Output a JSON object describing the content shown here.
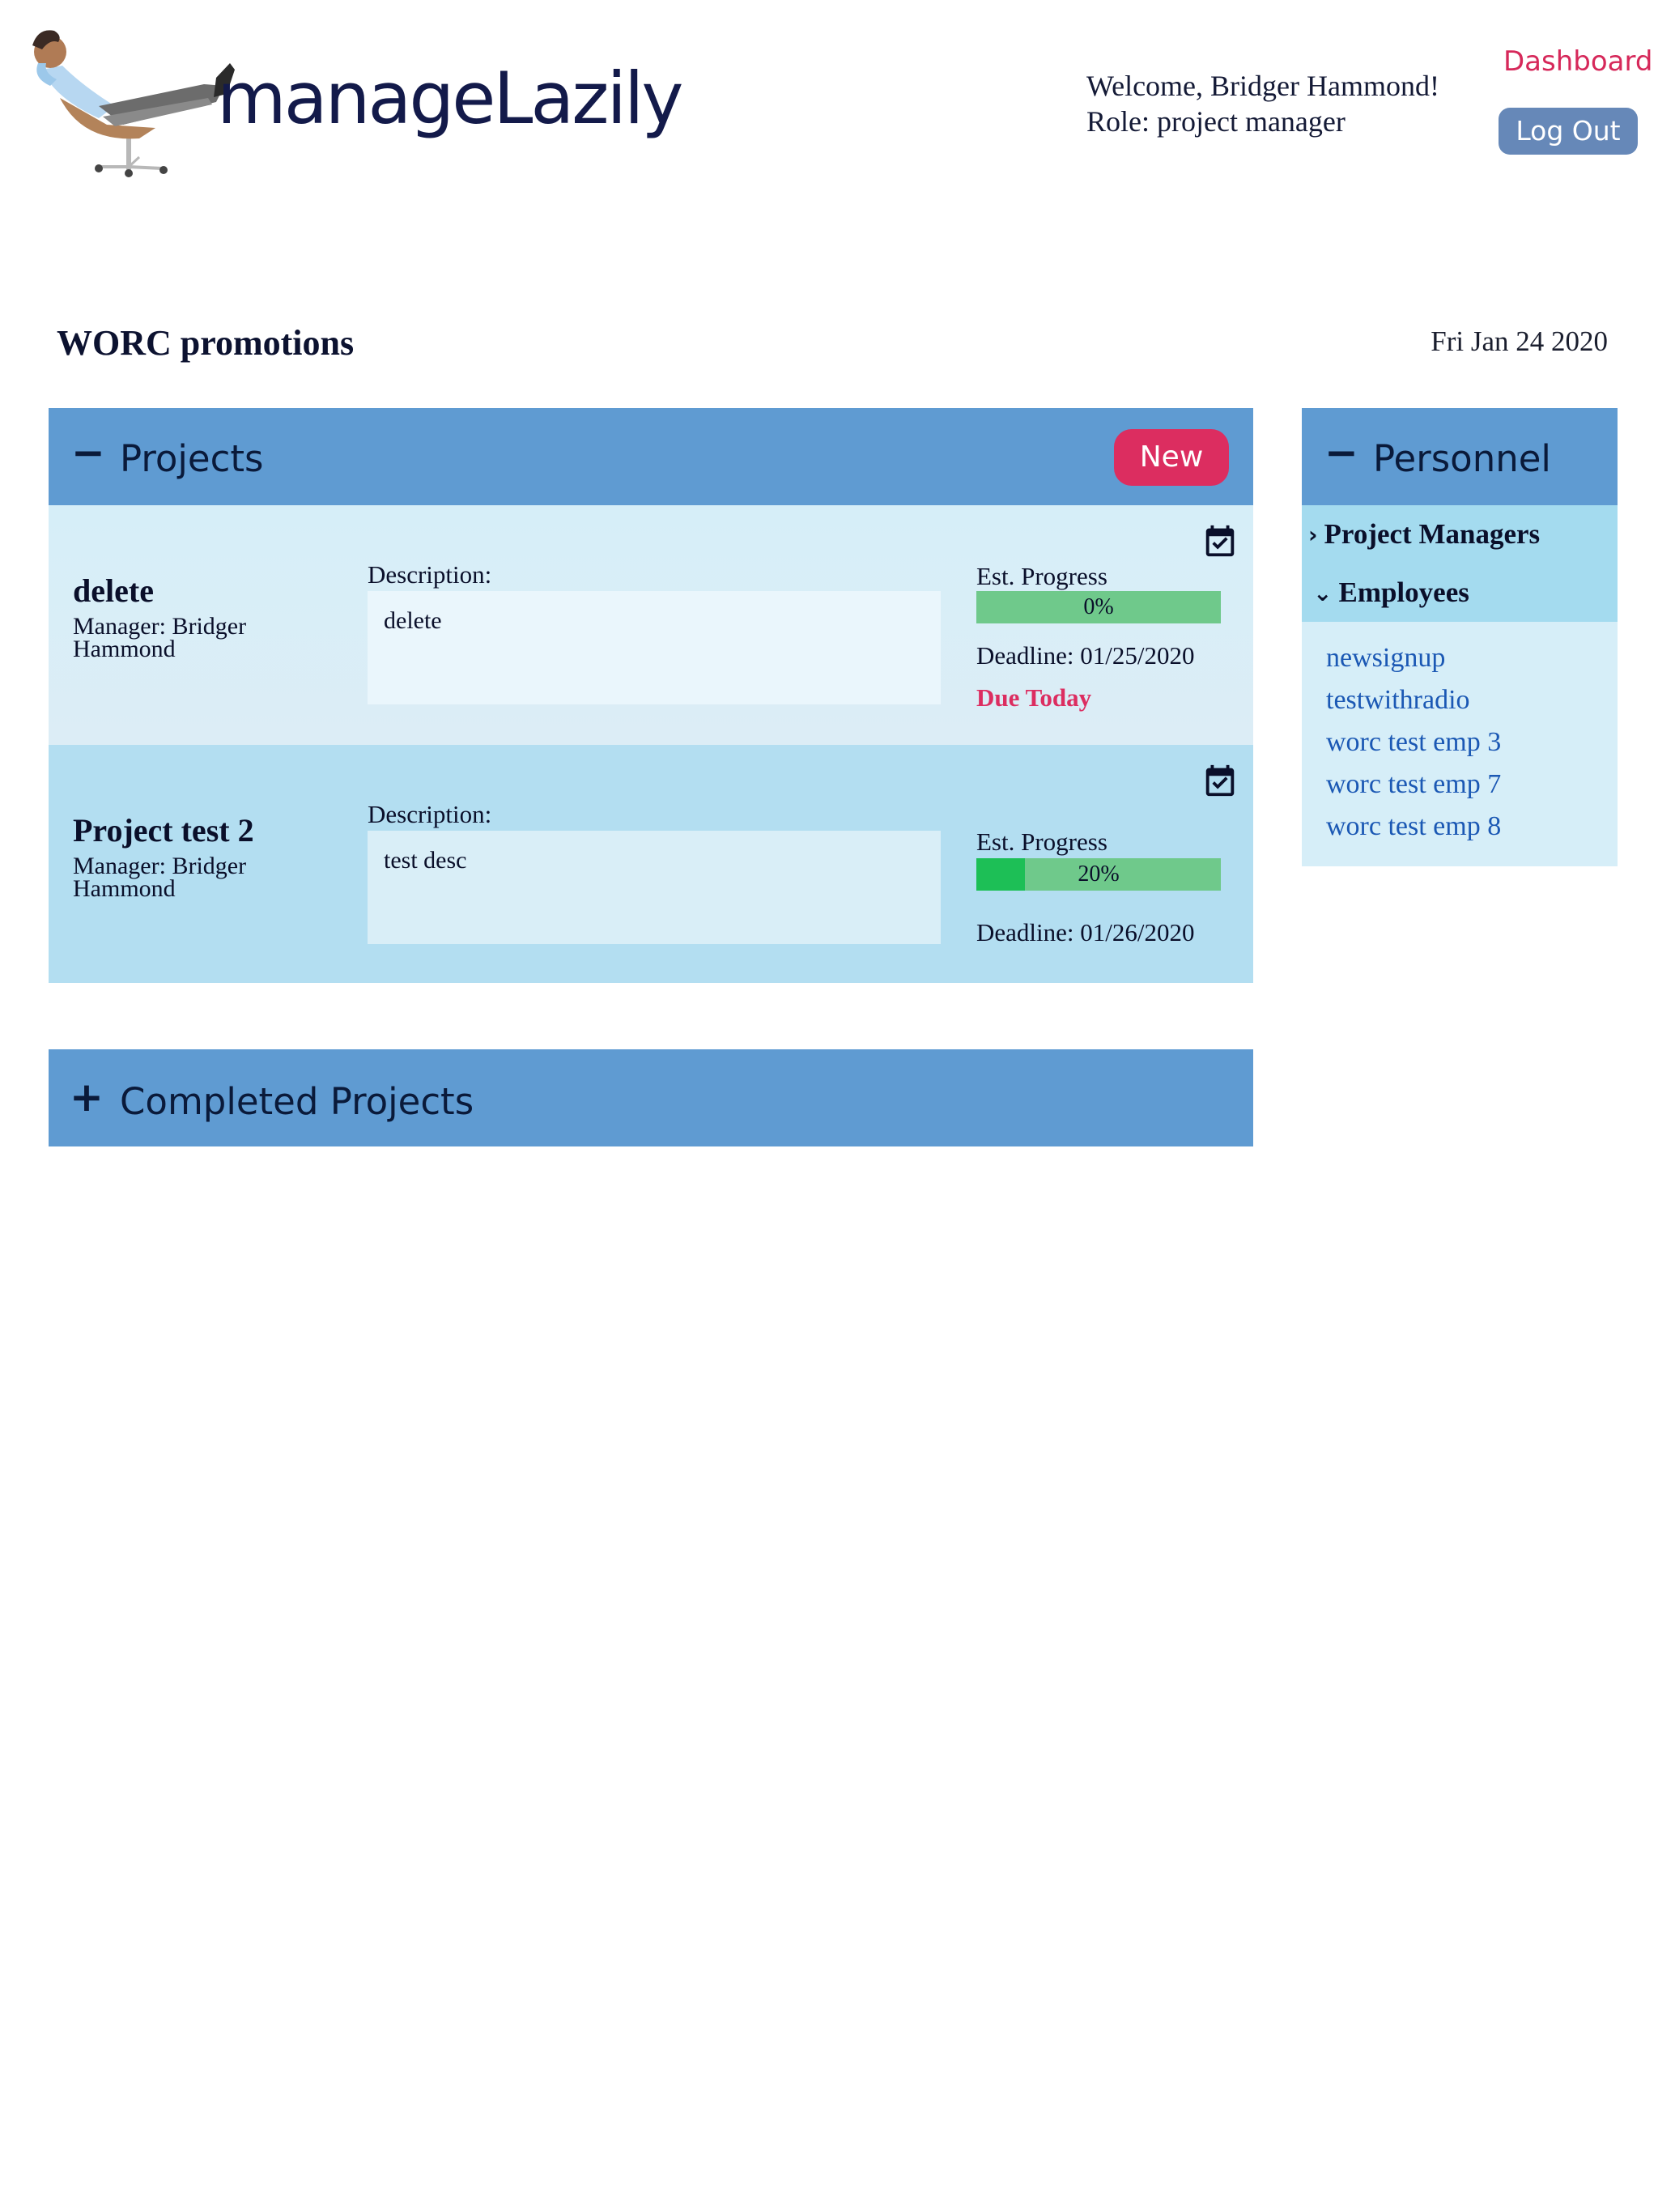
{
  "app": {
    "name": "manageLazily"
  },
  "header": {
    "welcome": "Welcome, Bridger Hammond!",
    "role": "Role: project manager",
    "nav_dashboard": "Dashboard",
    "logout_label": "Log Out"
  },
  "page": {
    "title": "WORC promotions",
    "date": "Fri Jan 24 2020"
  },
  "projects_panel": {
    "toggle": "−",
    "title": "Projects",
    "new_label": "New",
    "items": [
      {
        "name": "delete",
        "manager": "Manager: Bridger Hammond",
        "description_label": "Description:",
        "description": "delete",
        "progress_label": "Est. Progress",
        "progress_text": "0%",
        "progress_fraction": 0.0,
        "deadline": "Deadline:  01/25/2020",
        "status": "Due Today",
        "icon": "calendar-check-icon"
      },
      {
        "name": "Project test 2",
        "manager": "Manager: Bridger Hammond",
        "description_label": "Description:",
        "description": "test desc",
        "progress_label": "Est. Progress",
        "progress_text": "20%",
        "progress_fraction": 0.2,
        "deadline": "Deadline:  01/26/2020",
        "status": "",
        "icon": "calendar-check-icon"
      }
    ]
  },
  "completed_panel": {
    "toggle": "+",
    "title": "Completed Projects"
  },
  "personnel_panel": {
    "toggle": "−",
    "title": "Personnel",
    "groups": [
      {
        "chevron": "›",
        "label": "Project Managers",
        "expanded": false
      },
      {
        "chevron": "⌄",
        "label": "Employees",
        "expanded": true
      }
    ],
    "employees": [
      "newsignup",
      "testwithradio",
      "worc test emp 3",
      "worc test emp 7",
      "worc test emp 8"
    ]
  },
  "colors": {
    "accent": "#dc2d60",
    "panel_header": "#5f9bd2",
    "logout_button": "#6688b8",
    "progress_bar": "#6fc98b",
    "progress_fill": "#1dbf56",
    "link": "#1b58b4"
  }
}
